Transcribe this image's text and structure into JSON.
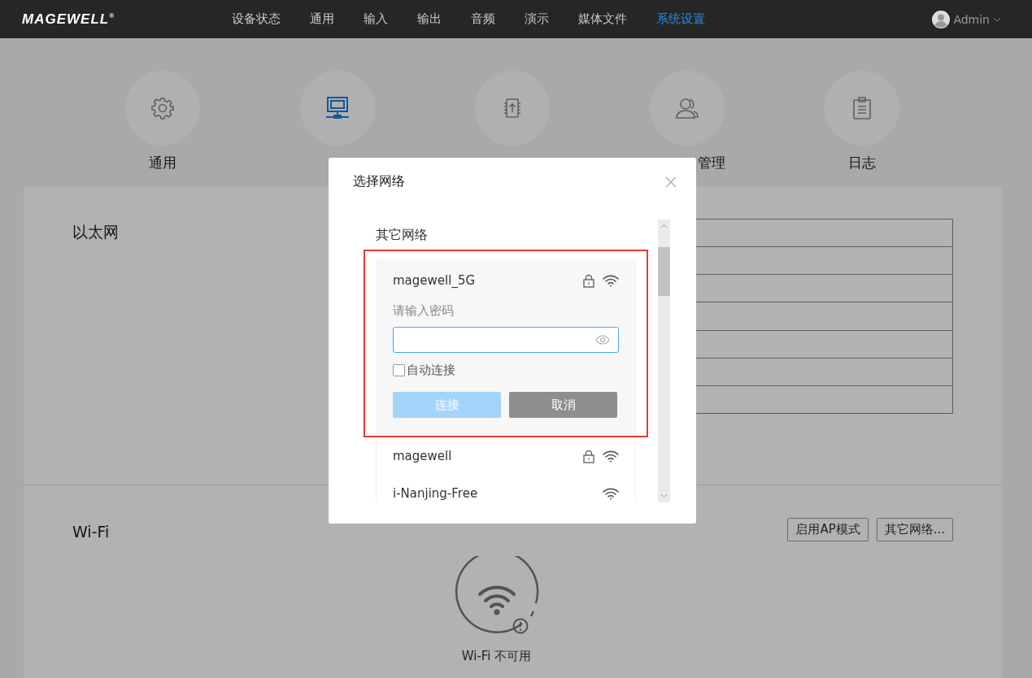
{
  "nav": {
    "logo": "MAGEWELL$^{®}$",
    "items": [
      {
        "label": "设备状态",
        "selected": false
      },
      {
        "label": "通用",
        "selected": false
      },
      {
        "label": "输入",
        "selected": false
      },
      {
        "label": "输出",
        "selected": false
      },
      {
        "label": "音频",
        "selected": false
      },
      {
        "label": "演示",
        "selected": false
      },
      {
        "label": "媒体文件",
        "selected": false
      },
      {
        "label": "系统设置",
        "selected": true
      }
    ],
    "user": "Admin"
  },
  "categories": [
    {
      "label": "通用",
      "selected": false
    },
    {
      "selected": true
    },
    {
      "selected": false
    },
    {
      "label": "管理",
      "selected": false
    },
    {
      "label": "日志",
      "selected": false
    }
  ],
  "ethernet": {
    "title": "以太网"
  },
  "wifi": {
    "title": "Wi-Fi",
    "buttons": [
      "启用AP模式",
      "其它网络..."
    ],
    "status": "Wi-Fi 不可用"
  },
  "dialog": {
    "title": "选择网络",
    "section": "其它网络",
    "networks": [
      {
        "name": "magewell_5G",
        "secured": true,
        "expanded": true,
        "highlighted": true,
        "password_label": "请输入密码",
        "auto_connect": {
          "label": "自动连接",
          "checked": false
        },
        "buttons": [
          {
            "label": "连接",
            "kind": "primary",
            "disabled": true
          },
          {
            "label": "取消",
            "kind": "cancel",
            "disabled": false
          }
        ]
      },
      {
        "name": "magewell",
        "secured": true,
        "expanded": false,
        "highlighted": false
      },
      {
        "name": "i-Nanjing-Free",
        "secured": false,
        "expanded": false,
        "highlighted": false
      }
    ]
  }
}
